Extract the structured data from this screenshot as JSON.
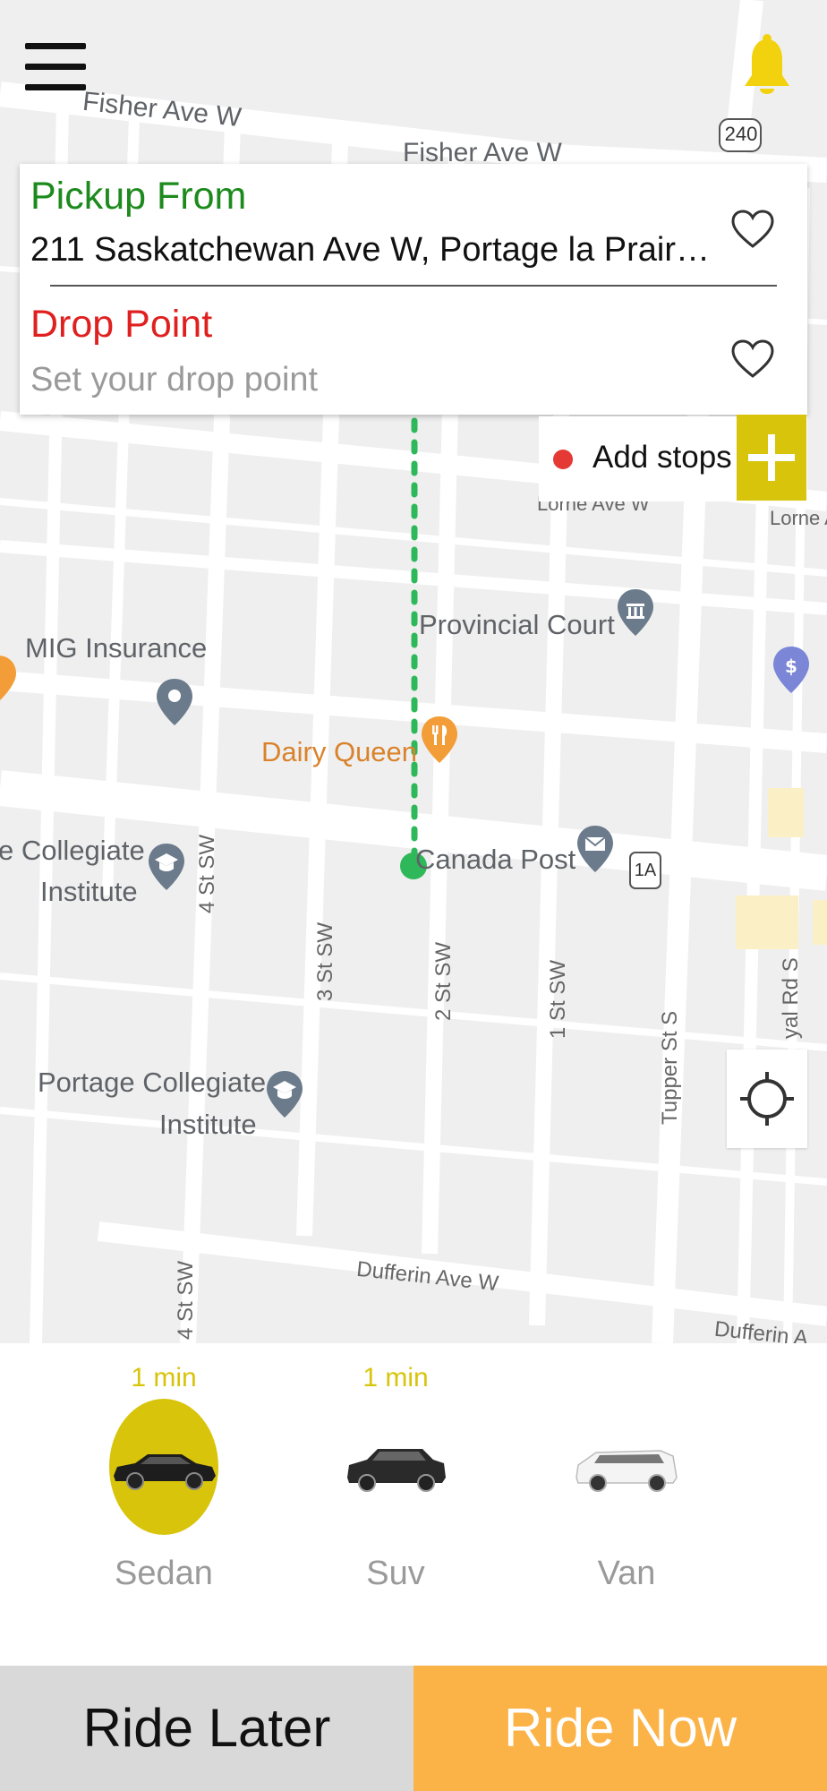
{
  "colors": {
    "pickup": "#1c8a1c",
    "drop": "#e01f1f",
    "accent": "#d8c40a",
    "ride_now": "#fbb347",
    "ride_later": "#d9d9d9",
    "route": "#2fb85a"
  },
  "header": {
    "menu_icon": "hamburger-menu-icon",
    "bell_icon": "bell-icon"
  },
  "location": {
    "pickup_title": "Pickup From",
    "pickup_value": "211 Saskatchewan Ave W, Portage la Prairie,...",
    "drop_title": "Drop Point",
    "drop_placeholder": "Set your drop point",
    "favorite_icon": "heart-outline-icon"
  },
  "stops": {
    "label": "Add stops",
    "add_icon": "plus-icon"
  },
  "map": {
    "labels": {
      "fisher1": "Fisher Ave W",
      "fisher2": "Fisher Ave W",
      "route240": "240",
      "lorne1": "Lorne Ave W",
      "lorne2": "Lorne A",
      "provincial": "Provincial Court",
      "mig": "MIG Insurance",
      "dairy": "Dairy Queen",
      "collegiate1a": "e Collegiate",
      "collegiate1b": "Institute",
      "canada_post": "Canada Post",
      "route1a": "1A",
      "st4a": "4 St SW",
      "st3": "3 St SW",
      "st2": "2 St SW",
      "st1": "1 St SW",
      "tupper": "Tupper St S",
      "royal": "yal Rd S",
      "portage_a": "Portage Collegiate",
      "portage_b": "Institute",
      "dufferin1": "Dufferin Ave W",
      "dufferin2": "Dufferin A",
      "st4b": "4 St SW"
    },
    "locate_icon": "crosshair-locate-icon"
  },
  "vehicles": [
    {
      "name": "Sedan",
      "eta": "1 min",
      "selected": true
    },
    {
      "name": "Suv",
      "eta": "1 min",
      "selected": false
    },
    {
      "name": "Van",
      "eta": "",
      "selected": false
    }
  ],
  "actions": {
    "ride_later": "Ride Later",
    "ride_now": "Ride Now"
  }
}
